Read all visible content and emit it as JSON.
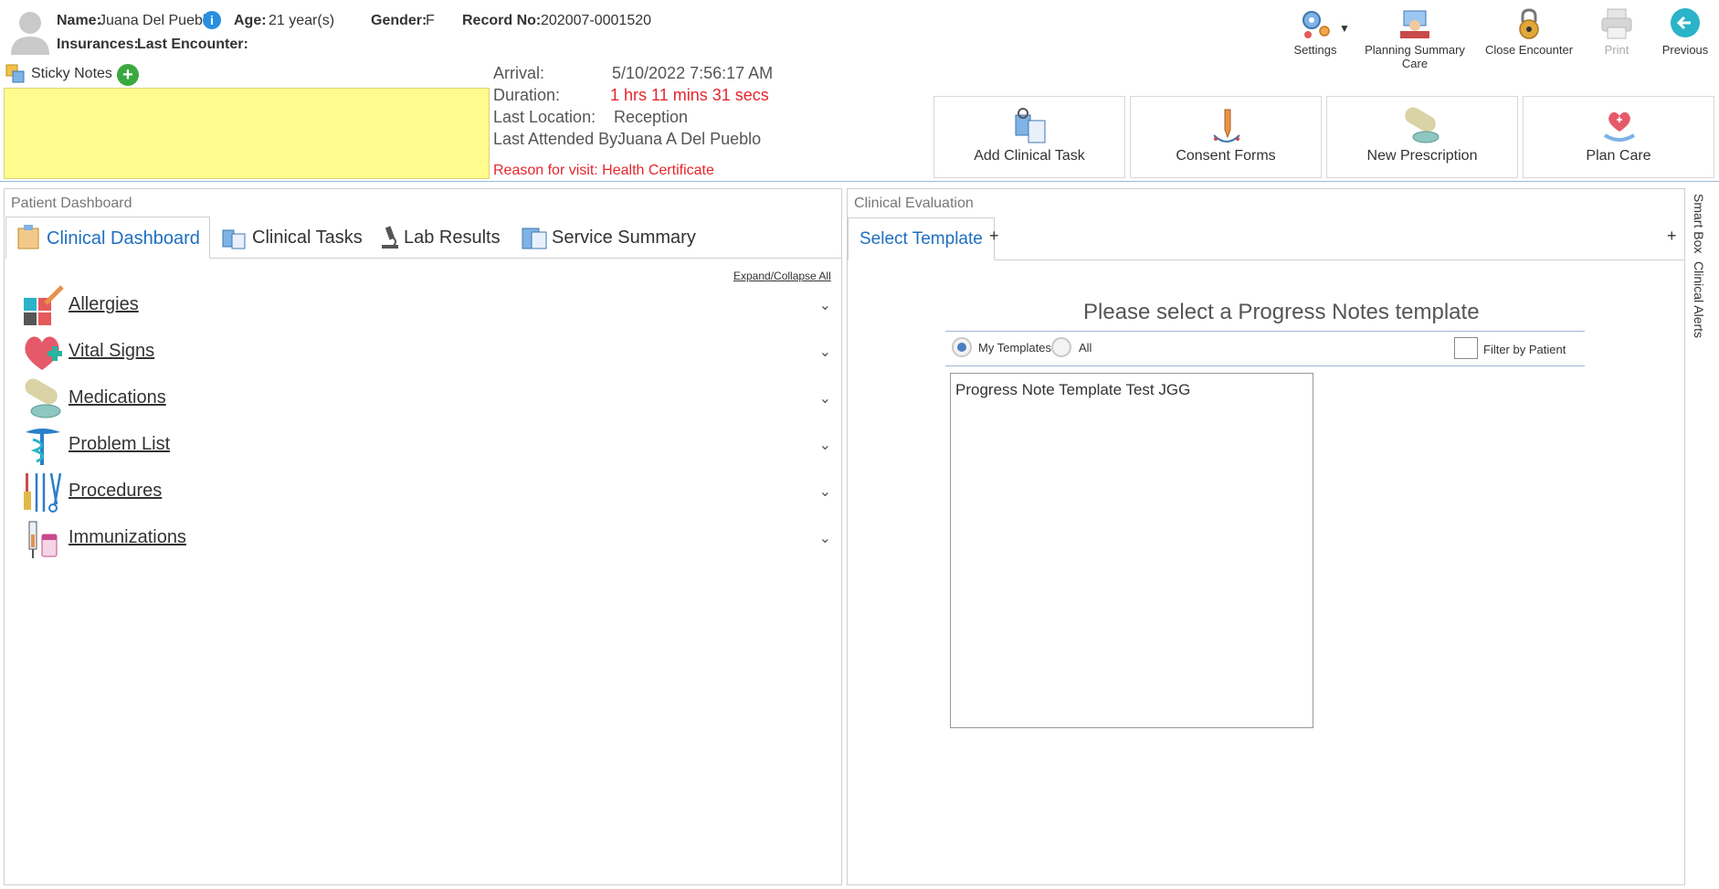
{
  "patient": {
    "name_label": "Name:",
    "name": "Juana Del Pueblo",
    "age_label": "Age:",
    "age": "21 year(s)",
    "gender_label": "Gender:",
    "gender": "F",
    "record_label": "Record No:",
    "record": "202007-0001520",
    "insurances_label": "Insurances:",
    "last_encounter_label": "Last Encounter:"
  },
  "sticky": {
    "label": "Sticky Notes"
  },
  "encounter": {
    "arrival_label": "Arrival:",
    "arrival": "5/10/2022 7:56:17 AM",
    "duration_label": "Duration:",
    "duration": "1 hrs 11 mins 31 secs",
    "location_label": "Last Location:",
    "location": "Reception",
    "attended_label": "Last Attended By:",
    "attended": "Juana A Del Pueblo",
    "reason": "Reason for visit: Health Certificate"
  },
  "toolbar": {
    "settings": "Settings",
    "planning": "Planning Summary Care",
    "close": "Close Encounter",
    "print": "Print",
    "previous": "Previous"
  },
  "actions": {
    "add_task": "Add Clinical Task",
    "consent": "Consent Forms",
    "prescription": "New Prescription",
    "plan_care": "Plan Care"
  },
  "dashboard": {
    "title": "Patient Dashboard",
    "tabs": [
      "Clinical Dashboard",
      "Clinical Tasks",
      "Lab Results",
      "Service Summary"
    ],
    "expand": "Expand/Collapse All",
    "sections": [
      "Allergies",
      "Vital Signs",
      "Medications",
      "Problem List",
      "Procedures",
      "Immunizations"
    ]
  },
  "evaluation": {
    "title": "Clinical Evaluation",
    "tab": "Select Template",
    "add_tab": "+",
    "add_right": "+",
    "prompt": "Please select a Progress Notes template",
    "my_templates": "My Templates",
    "all": "All",
    "filter": "Filter by Patient",
    "templates": [
      "Progress Note Template Test JGG"
    ]
  },
  "side": {
    "smart_box": "Smart Box",
    "clinical_alerts": "Clinical Alerts"
  },
  "colors": {
    "accent": "#1e6fc0",
    "alert": "#e8242b",
    "sticky": "#fffb8c"
  }
}
